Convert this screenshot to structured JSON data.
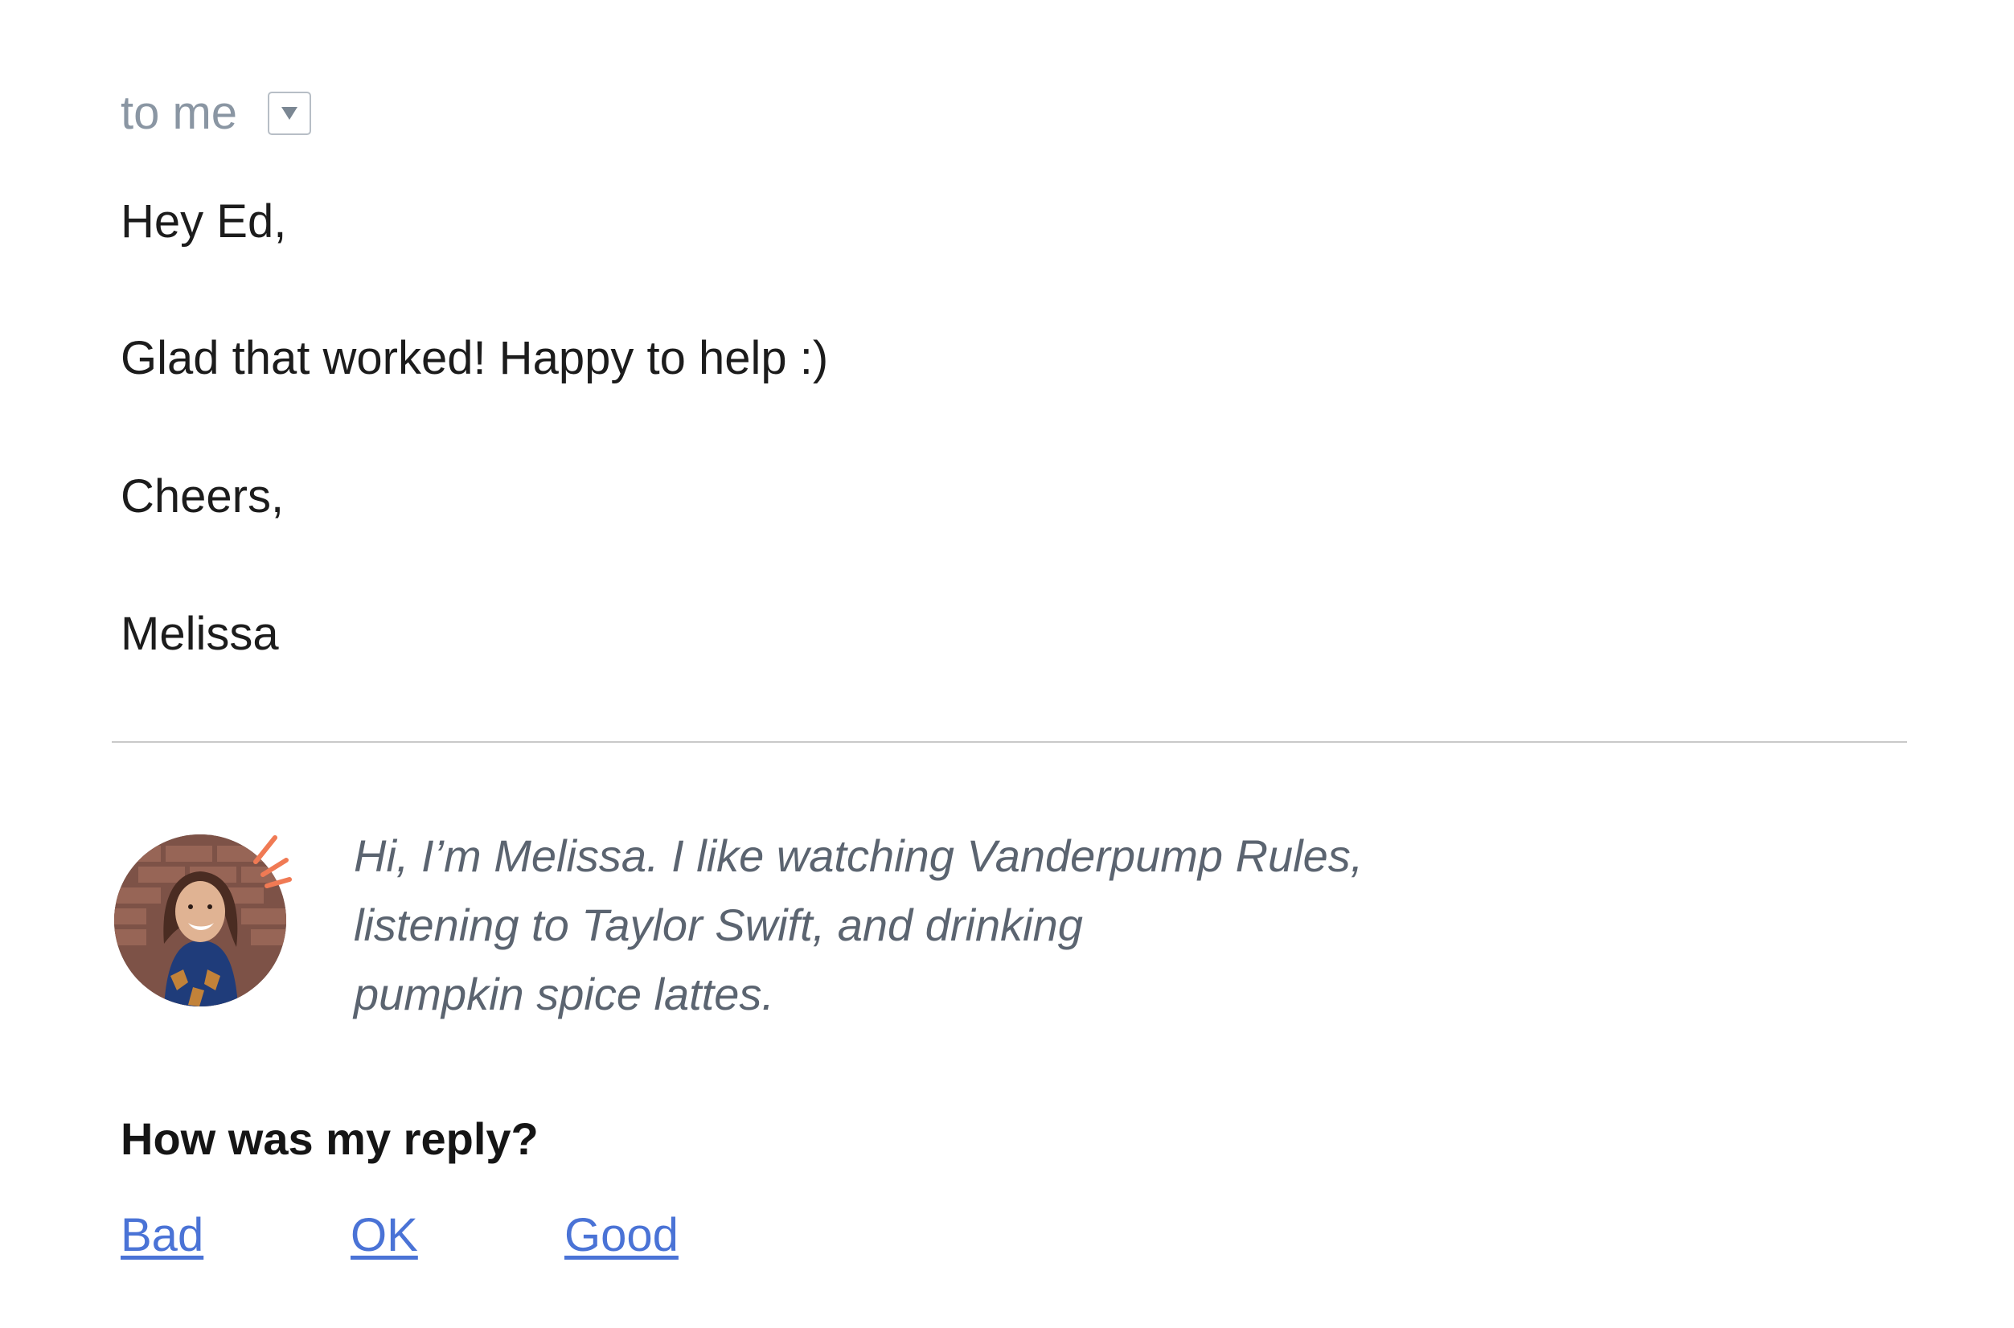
{
  "header": {
    "recipient_text": "to me",
    "dropdown_icon": "chevron-down-icon"
  },
  "message": {
    "greeting": "Hey Ed,",
    "body": "Glad that worked! Happy to help :)",
    "closing": "Cheers,",
    "signature": "Melissa"
  },
  "signature_card": {
    "avatar_icon": "avatar",
    "accent_icon": "spark-icon",
    "accent_color": "#f07a54",
    "bio_lines": [
      "Hi, I’m Melissa. I like watching Vanderpump Rules,",
      "listening to Taylor Swift, and drinking",
      "pumpkin spice lattes."
    ]
  },
  "feedback": {
    "title": "How was my reply?",
    "ratings": [
      "Bad",
      "OK",
      "Good"
    ],
    "link_color": "#4a73d6"
  }
}
